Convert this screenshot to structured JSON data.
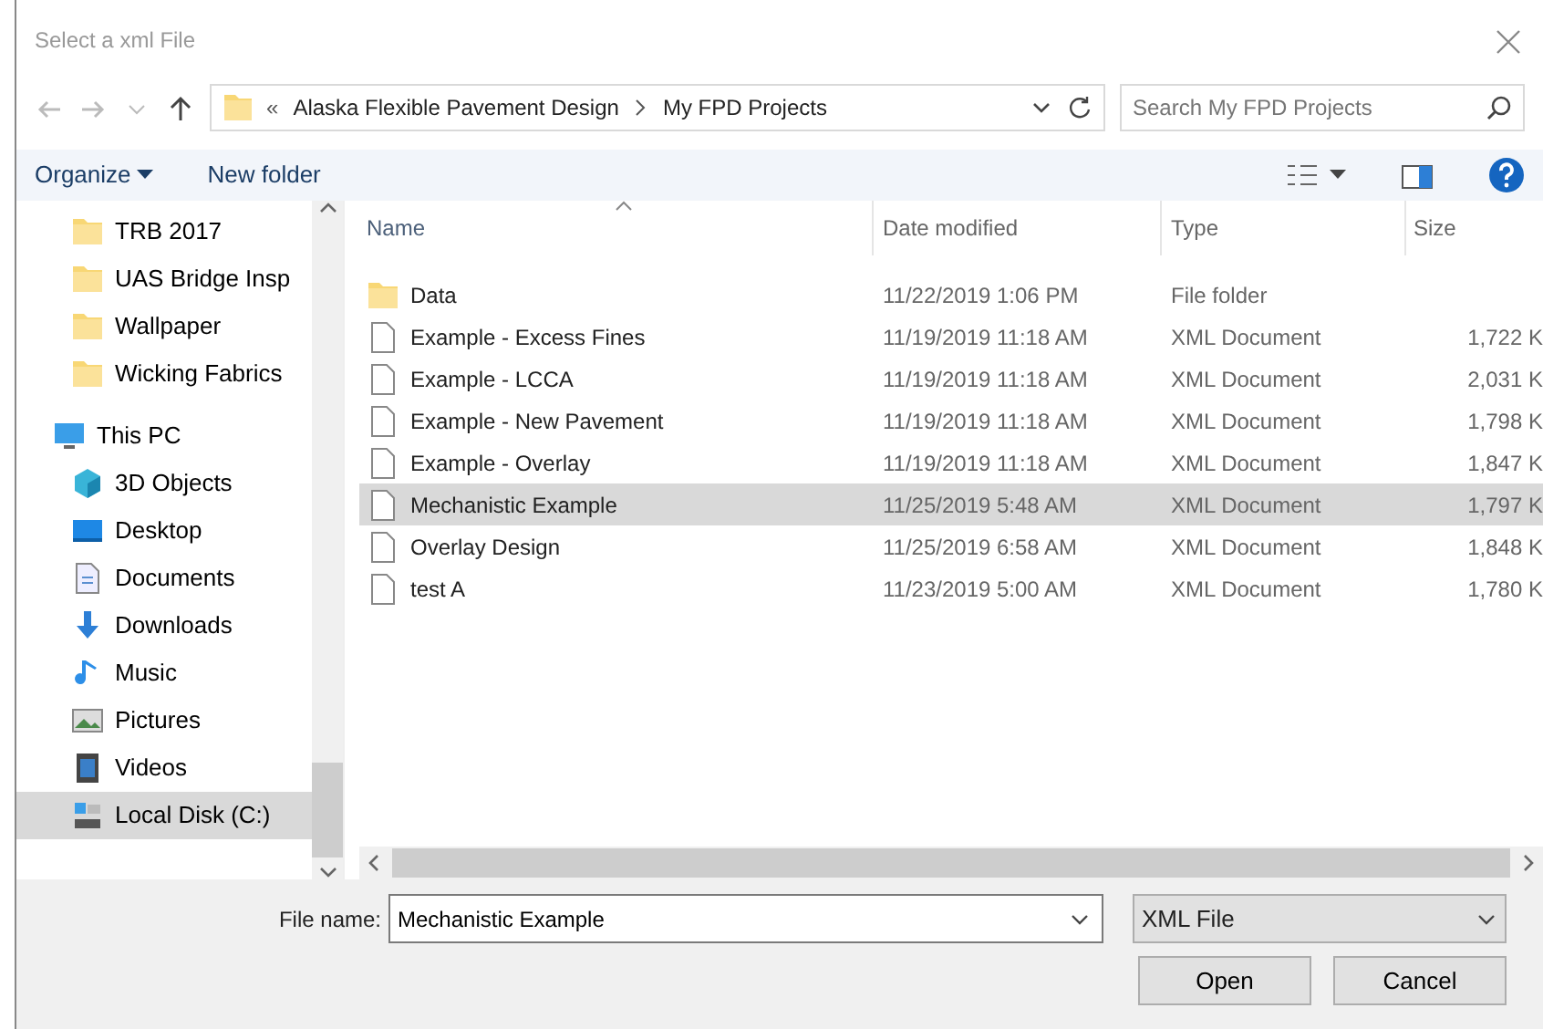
{
  "window": {
    "title": "Select a xml File"
  },
  "address": {
    "overflow": "«",
    "path": [
      "Alaska Flexible Pavement Design",
      "My FPD Projects"
    ]
  },
  "search": {
    "placeholder": "Search My FPD Projects"
  },
  "toolbar": {
    "organize": "Organize",
    "new_folder": "New folder"
  },
  "sidebar": {
    "items": [
      {
        "label": "TRB 2017",
        "kind": "folder",
        "selected": false
      },
      {
        "label": "UAS Bridge Insp",
        "kind": "folder",
        "selected": false
      },
      {
        "label": "Wallpaper",
        "kind": "folder",
        "selected": false
      },
      {
        "label": "Wicking Fabrics",
        "kind": "folder",
        "selected": false
      },
      {
        "label": "This PC",
        "kind": "pc",
        "selected": false,
        "children": [
          {
            "label": "3D Objects",
            "kind": "objects",
            "selected": false
          },
          {
            "label": "Desktop",
            "kind": "desktop",
            "selected": false
          },
          {
            "label": "Documents",
            "kind": "documents",
            "selected": false
          },
          {
            "label": "Downloads",
            "kind": "downloads",
            "selected": false
          },
          {
            "label": "Music",
            "kind": "music",
            "selected": false
          },
          {
            "label": "Pictures",
            "kind": "pictures",
            "selected": false
          },
          {
            "label": "Videos",
            "kind": "videos",
            "selected": false
          },
          {
            "label": "Local Disk (C:)",
            "kind": "disk",
            "selected": true
          }
        ]
      }
    ]
  },
  "table": {
    "columns": [
      "Name",
      "Date modified",
      "Type",
      "Size"
    ],
    "rows": [
      {
        "kind": "folder",
        "name": "Data",
        "date": "11/22/2019 1:06 PM",
        "type": "File folder",
        "size": "",
        "selected": false
      },
      {
        "kind": "file",
        "name": "Example - Excess Fines",
        "date": "11/19/2019 11:18 AM",
        "type": "XML Document",
        "size": "1,722 K",
        "selected": false
      },
      {
        "kind": "file",
        "name": "Example - LCCA",
        "date": "11/19/2019 11:18 AM",
        "type": "XML Document",
        "size": "2,031 K",
        "selected": false
      },
      {
        "kind": "file",
        "name": "Example - New Pavement",
        "date": "11/19/2019 11:18 AM",
        "type": "XML Document",
        "size": "1,798 K",
        "selected": false
      },
      {
        "kind": "file",
        "name": "Example - Overlay",
        "date": "11/19/2019 11:18 AM",
        "type": "XML Document",
        "size": "1,847 K",
        "selected": false
      },
      {
        "kind": "file",
        "name": "Mechanistic Example",
        "date": "11/25/2019 5:48 AM",
        "type": "XML Document",
        "size": "1,797 K",
        "selected": true
      },
      {
        "kind": "file",
        "name": "Overlay Design",
        "date": "11/25/2019 6:58 AM",
        "type": "XML Document",
        "size": "1,848 K",
        "selected": false
      },
      {
        "kind": "file",
        "name": "test A",
        "date": "11/23/2019 5:00 AM",
        "type": "XML Document",
        "size": "1,780 K",
        "selected": false
      }
    ]
  },
  "footer": {
    "file_name_label": "File name:",
    "file_name": "Mechanistic Example",
    "file_type": "XML File",
    "buttons": [
      "Open",
      "Cancel"
    ]
  }
}
